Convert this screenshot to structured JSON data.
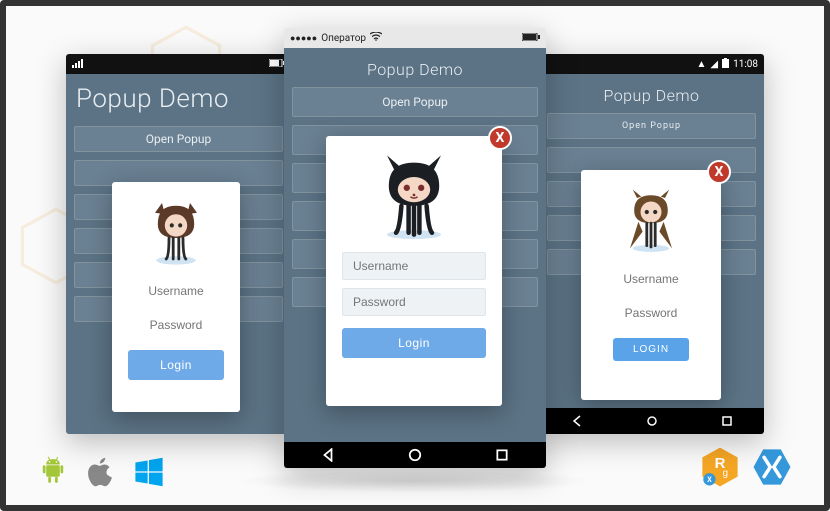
{
  "app_title": "Popup Demo",
  "open_popup_label": "Open Popup",
  "close_label": "X",
  "fields": {
    "username_placeholder": "Username",
    "password_placeholder": "Password"
  },
  "login_label": "Login",
  "login_label_upper": "LOGIN",
  "status": {
    "ios_carrier": "Оператор",
    "ios_wifi_icon": "wifi",
    "android_time": "11:08"
  },
  "icons": {
    "left_avatar": "octocat-girl-brown-hair",
    "center_avatar": "octocat-black",
    "right_avatar": "octocat-jedi-robe",
    "platforms": [
      "android-icon",
      "apple-icon",
      "windows-icon"
    ],
    "vendors": [
      "rg-hex-icon",
      "xamarin-icon"
    ]
  },
  "colors": {
    "app_bg": "#5b7385",
    "button_bg": "#6a8193",
    "login_blue": "#6ea9e8",
    "close_red": "#c0392b"
  }
}
